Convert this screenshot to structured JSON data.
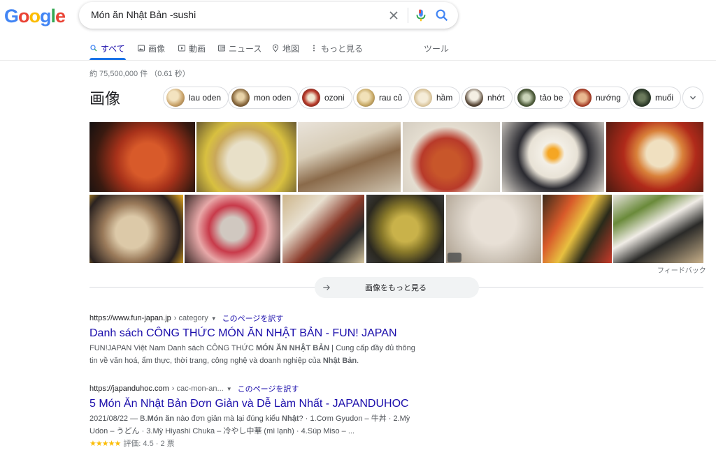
{
  "search": {
    "query": "Món ăn Nhật Bản -sushi"
  },
  "logo": [
    "G",
    "o",
    "o",
    "g",
    "l",
    "e"
  ],
  "logo_colors": [
    "#4285f4",
    "#ea4335",
    "#fbbc05",
    "#4285f4",
    "#34a853",
    "#ea4335"
  ],
  "tabs": [
    {
      "label": "すべて",
      "icon": "search-icon"
    },
    {
      "label": "画像",
      "icon": "image-icon"
    },
    {
      "label": "動画",
      "icon": "video-icon"
    },
    {
      "label": "ニュース",
      "icon": "news-icon"
    },
    {
      "label": "地図",
      "icon": "map-pin-icon"
    },
    {
      "label": "もっと見る",
      "icon": "kebab-icon"
    },
    {
      "label": "ツール",
      "icon": ""
    }
  ],
  "stats": "約 75,500,000 件 （0.61 秒）",
  "images": {
    "heading": "画像",
    "chips": [
      "lau oden",
      "mon oden",
      "ozoni",
      "rau củ",
      "hầm",
      "nhớt",
      "tảo bẹ",
      "nướng",
      "muối"
    ],
    "chip_colors": [
      "#c9a36a",
      "#8a6a3f",
      "#b83a2a",
      "#c7a865",
      "#d9c49b",
      "#5b4a3a",
      "#4f5d3c",
      "#a33b25",
      "#2f3d2b"
    ],
    "feedback": "フィードバック",
    "more_label": "画像をもっと見る"
  },
  "results": [
    {
      "url": "https://www.fun-japan.jp",
      "crumb": "› category",
      "translate": "このページを訳す",
      "title": "Danh sách CÔNG THỨC MÓN ĂN NHẬT BẢN - FUN! JAPAN",
      "snippet_parts": [
        {
          "t": "FUN!JAPAN Việt Nam Danh sách CÔNG THỨC ",
          "b": false
        },
        {
          "t": "MÓN ĂN NHẬT BẢN",
          "b": true
        },
        {
          "t": " | Cung cấp đầy đủ thông tin về văn hoá, ẩm thực, thời trang, công nghệ và doanh nghiệp của ",
          "b": false
        },
        {
          "t": "Nhật Bản",
          "b": true
        },
        {
          "t": ".",
          "b": false
        }
      ]
    },
    {
      "url": "https://japanduhoc.com",
      "crumb": "› cac-mon-an...",
      "translate": "このページを訳す",
      "title": "5 Món Ăn Nhật Bản Đơn Giản và Dễ Làm Nhất - JAPANDUHOC",
      "snippet_parts": [
        {
          "t": "2021/08/22 — B.",
          "b": false
        },
        {
          "t": "Món ăn",
          "b": true
        },
        {
          "t": " nào đơn giản mà lại đúng kiểu ",
          "b": false
        },
        {
          "t": "Nhật",
          "b": true
        },
        {
          "t": "? · 1.Cơm Gyudon – 牛丼 · 2.Mỳ Udon – うどん · 3.Mỳ Hiyashi Chuka – 冷やし中華 (mì lạnh) · 4.Súp Miso – ...",
          "b": false
        }
      ],
      "stars": "★★★★★",
      "rating": "評価: 4.5 · 2 票"
    }
  ]
}
